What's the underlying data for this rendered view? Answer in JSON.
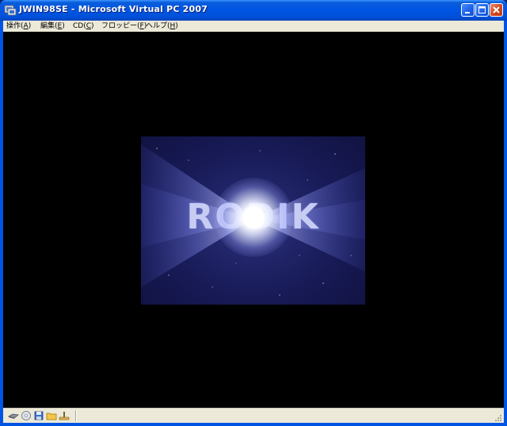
{
  "window": {
    "title": "JWIN98SE - Microsoft Virtual PC 2007"
  },
  "title_buttons": [
    "minimize",
    "maximize",
    "close"
  ],
  "menu": {
    "items": [
      {
        "label": "操作(",
        "key": "A",
        "end": ")"
      },
      {
        "label": "編集(",
        "key": "E",
        "end": ")"
      },
      {
        "label": "CD(",
        "key": "C",
        "end": ")"
      },
      {
        "label": "フロッピー(",
        "key": "F",
        "end": ")"
      },
      {
        "label": "ヘルプ(",
        "key": "H",
        "end": ")"
      }
    ]
  },
  "splash": {
    "logo_text": "RODIK"
  },
  "status_icons": [
    "hard-disk-icon",
    "cd-drive-icon",
    "floppy-icon",
    "shared-folder-icon",
    "network-icon"
  ],
  "colors": {
    "titlebar": "#0054e3",
    "menubar": "#ece9d8",
    "screen": "#000000",
    "splash_bg": "#171a55",
    "logo": "#c7ccf3"
  }
}
